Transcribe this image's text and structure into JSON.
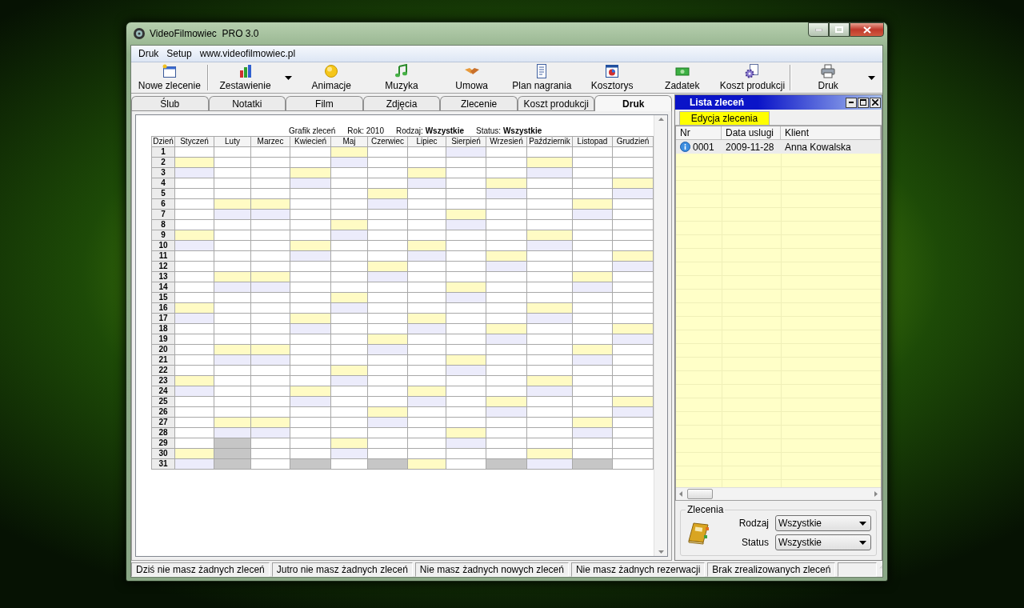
{
  "window": {
    "title": "VideoFilmowiec  PRO 3.0"
  },
  "menu": [
    "Druk",
    "Setup",
    "www.videofilmowiec.pl"
  ],
  "toolbar": [
    {
      "label": "Nowe zlecenie",
      "dropdown": false
    },
    {
      "label": "Zestawienie",
      "dropdown": true
    },
    {
      "label": "Animacje",
      "dropdown": false
    },
    {
      "label": "Muzyka",
      "dropdown": false
    },
    {
      "label": "Umowa",
      "dropdown": false
    },
    {
      "label": "Plan nagrania",
      "dropdown": false
    },
    {
      "label": "Kosztorys",
      "dropdown": false
    },
    {
      "label": "Zadatek",
      "dropdown": false
    },
    {
      "label": "Koszt produkcji",
      "dropdown": false
    },
    {
      "label": "Druk",
      "dropdown": true
    }
  ],
  "tabs": [
    {
      "label": "Ślub",
      "selected": false
    },
    {
      "label": "Notatki",
      "selected": false
    },
    {
      "label": "Film",
      "selected": false
    },
    {
      "label": "Zdjęcia",
      "selected": false
    },
    {
      "label": "Zlecenie",
      "selected": false
    },
    {
      "label": "Koszt produkcji",
      "selected": false
    },
    {
      "label": "Druk",
      "selected": true
    }
  ],
  "schedule": {
    "title": "Grafik zleceń",
    "year": "Rok: 2010",
    "type": "Rodzaj: **Wszystkie**",
    "status": "Status: **Wszystkie**",
    "corner": "Dzień",
    "months": [
      "Styczeń",
      "Luty",
      "Marzec",
      "Kwiecień",
      "Maj",
      "Czerwiec",
      "Lipiec",
      "Sierpień",
      "Wrzesień",
      "Październik",
      "Listopad",
      "Grudzień"
    ],
    "rows": [
      {
        "day": "1",
        "cells": [
          {
            "color": "#ffffff"
          },
          {
            "color": "#ffffff"
          },
          {
            "color": "#ffffff"
          },
          {
            "color": "#ffffff"
          },
          {
            "color": "#fffbc4"
          },
          {
            "color": "#ffffff"
          },
          {
            "color": "#ffffff"
          },
          {
            "color": "#ececfb"
          },
          {
            "color": "#ffffff"
          },
          {
            "color": "#ffffff"
          },
          {
            "color": "#ffffff"
          },
          {
            "color": "#ffffff"
          }
        ]
      },
      {
        "day": "2",
        "cells": [
          {
            "color": "#fffbc4"
          },
          {
            "color": "#ffffff"
          },
          {
            "color": "#ffffff"
          },
          {
            "color": "#ffffff"
          },
          {
            "color": "#ececfb"
          },
          {
            "color": "#ffffff"
          },
          {
            "color": "#ffffff"
          },
          {
            "color": "#ffffff"
          },
          {
            "color": "#ffffff"
          },
          {
            "color": "#fffbc4"
          },
          {
            "color": "#ffffff"
          },
          {
            "color": "#ffffff"
          }
        ]
      },
      {
        "day": "3",
        "cells": [
          {
            "color": "#ececfb"
          },
          {
            "color": "#ffffff"
          },
          {
            "color": "#ffffff"
          },
          {
            "color": "#fffbc4"
          },
          {
            "color": "#ffffff"
          },
          {
            "color": "#ffffff"
          },
          {
            "color": "#fffbc4"
          },
          {
            "color": "#ffffff"
          },
          {
            "color": "#ffffff"
          },
          {
            "color": "#ececfb"
          },
          {
            "color": "#ffffff"
          },
          {
            "color": "#ffffff"
          }
        ]
      },
      {
        "day": "4",
        "cells": [
          {
            "color": "#ffffff"
          },
          {
            "color": "#ffffff"
          },
          {
            "color": "#ffffff"
          },
          {
            "color": "#ececfb"
          },
          {
            "color": "#ffffff"
          },
          {
            "color": "#ffffff"
          },
          {
            "color": "#ececfb"
          },
          {
            "color": "#ffffff"
          },
          {
            "color": "#fffbc4"
          },
          {
            "color": "#ffffff"
          },
          {
            "color": "#ffffff"
          },
          {
            "color": "#fffbc4"
          }
        ]
      },
      {
        "day": "5",
        "cells": [
          {
            "color": "#ffffff"
          },
          {
            "color": "#ffffff"
          },
          {
            "color": "#ffffff"
          },
          {
            "color": "#ffffff"
          },
          {
            "color": "#ffffff"
          },
          {
            "color": "#fffbc4"
          },
          {
            "color": "#ffffff"
          },
          {
            "color": "#ffffff"
          },
          {
            "color": "#ececfb"
          },
          {
            "color": "#ffffff"
          },
          {
            "color": "#ffffff"
          },
          {
            "color": "#ececfb"
          }
        ]
      },
      {
        "day": "6",
        "cells": [
          {
            "color": "#ffffff"
          },
          {
            "color": "#fffbc4"
          },
          {
            "color": "#fffbc4"
          },
          {
            "color": "#ffffff"
          },
          {
            "color": "#ffffff"
          },
          {
            "color": "#ececfb"
          },
          {
            "color": "#ffffff"
          },
          {
            "color": "#ffffff"
          },
          {
            "color": "#ffffff"
          },
          {
            "color": "#ffffff"
          },
          {
            "color": "#fffbc4"
          },
          {
            "color": "#ffffff"
          }
        ]
      },
      {
        "day": "7",
        "cells": [
          {
            "color": "#ffffff"
          },
          {
            "color": "#ececfb"
          },
          {
            "color": "#ececfb"
          },
          {
            "color": "#ffffff"
          },
          {
            "color": "#ffffff"
          },
          {
            "color": "#ffffff"
          },
          {
            "color": "#ffffff"
          },
          {
            "color": "#fffbc4"
          },
          {
            "color": "#ffffff"
          },
          {
            "color": "#ffffff"
          },
          {
            "color": "#ececfb"
          },
          {
            "color": "#ffffff"
          }
        ]
      },
      {
        "day": "8",
        "cells": [
          {
            "color": "#ffffff"
          },
          {
            "color": "#ffffff"
          },
          {
            "color": "#ffffff"
          },
          {
            "color": "#ffffff"
          },
          {
            "color": "#fffbc4"
          },
          {
            "color": "#ffffff"
          },
          {
            "color": "#ffffff"
          },
          {
            "color": "#ececfb"
          },
          {
            "color": "#ffffff"
          },
          {
            "color": "#ffffff"
          },
          {
            "color": "#ffffff"
          },
          {
            "color": "#ffffff"
          }
        ]
      },
      {
        "day": "9",
        "cells": [
          {
            "color": "#fffbc4"
          },
          {
            "color": "#ffffff"
          },
          {
            "color": "#ffffff"
          },
          {
            "color": "#ffffff"
          },
          {
            "color": "#ececfb"
          },
          {
            "color": "#ffffff"
          },
          {
            "color": "#ffffff"
          },
          {
            "color": "#ffffff"
          },
          {
            "color": "#ffffff"
          },
          {
            "color": "#fffbc4"
          },
          {
            "color": "#ffffff"
          },
          {
            "color": "#ffffff"
          }
        ]
      },
      {
        "day": "10",
        "cells": [
          {
            "color": "#ececfb"
          },
          {
            "color": "#ffffff"
          },
          {
            "color": "#ffffff"
          },
          {
            "color": "#fffbc4"
          },
          {
            "color": "#ffffff"
          },
          {
            "color": "#ffffff"
          },
          {
            "color": "#fffbc4"
          },
          {
            "color": "#ffffff"
          },
          {
            "color": "#ffffff"
          },
          {
            "color": "#ececfb"
          },
          {
            "color": "#ffffff"
          },
          {
            "color": "#ffffff"
          }
        ]
      },
      {
        "day": "11",
        "cells": [
          {
            "color": "#ffffff"
          },
          {
            "color": "#ffffff"
          },
          {
            "color": "#ffffff"
          },
          {
            "color": "#ececfb"
          },
          {
            "color": "#ffffff"
          },
          {
            "color": "#ffffff"
          },
          {
            "color": "#ececfb"
          },
          {
            "color": "#ffffff"
          },
          {
            "color": "#fffbc4"
          },
          {
            "color": "#ffffff"
          },
          {
            "color": "#ffffff"
          },
          {
            "color": "#fffbc4"
          }
        ]
      },
      {
        "day": "12",
        "cells": [
          {
            "color": "#ffffff"
          },
          {
            "color": "#ffffff"
          },
          {
            "color": "#ffffff"
          },
          {
            "color": "#ffffff"
          },
          {
            "color": "#ffffff"
          },
          {
            "color": "#fffbc4"
          },
          {
            "color": "#ffffff"
          },
          {
            "color": "#ffffff"
          },
          {
            "color": "#ececfb"
          },
          {
            "color": "#ffffff"
          },
          {
            "color": "#ffffff"
          },
          {
            "color": "#ececfb"
          }
        ]
      },
      {
        "day": "13",
        "cells": [
          {
            "color": "#ffffff"
          },
          {
            "color": "#fffbc4"
          },
          {
            "color": "#fffbc4"
          },
          {
            "color": "#ffffff"
          },
          {
            "color": "#ffffff"
          },
          {
            "color": "#ececfb"
          },
          {
            "color": "#ffffff"
          },
          {
            "color": "#ffffff"
          },
          {
            "color": "#ffffff"
          },
          {
            "color": "#ffffff"
          },
          {
            "color": "#fffbc4"
          },
          {
            "color": "#ffffff"
          }
        ]
      },
      {
        "day": "14",
        "cells": [
          {
            "color": "#ffffff"
          },
          {
            "color": "#ececfb"
          },
          {
            "color": "#ececfb"
          },
          {
            "color": "#ffffff"
          },
          {
            "color": "#ffffff"
          },
          {
            "color": "#ffffff"
          },
          {
            "color": "#ffffff"
          },
          {
            "color": "#fffbc4"
          },
          {
            "color": "#ffffff"
          },
          {
            "color": "#ffffff"
          },
          {
            "color": "#ececfb"
          },
          {
            "color": "#ffffff"
          }
        ]
      },
      {
        "day": "15",
        "cells": [
          {
            "color": "#ffffff"
          },
          {
            "color": "#ffffff"
          },
          {
            "color": "#ffffff"
          },
          {
            "color": "#ffffff"
          },
          {
            "color": "#fffbc4"
          },
          {
            "color": "#ffffff"
          },
          {
            "color": "#ffffff"
          },
          {
            "color": "#ececfb"
          },
          {
            "color": "#ffffff"
          },
          {
            "color": "#ffffff"
          },
          {
            "color": "#ffffff"
          },
          {
            "color": "#ffffff"
          }
        ]
      },
      {
        "day": "16",
        "cells": [
          {
            "color": "#fffbc4"
          },
          {
            "color": "#ffffff"
          },
          {
            "color": "#ffffff"
          },
          {
            "color": "#ffffff"
          },
          {
            "color": "#ececfb"
          },
          {
            "color": "#ffffff"
          },
          {
            "color": "#ffffff"
          },
          {
            "color": "#ffffff"
          },
          {
            "color": "#ffffff"
          },
          {
            "color": "#fffbc4"
          },
          {
            "color": "#ffffff"
          },
          {
            "color": "#ffffff"
          }
        ]
      },
      {
        "day": "17",
        "cells": [
          {
            "color": "#ececfb"
          },
          {
            "color": "#ffffff"
          },
          {
            "color": "#ffffff"
          },
          {
            "color": "#fffbc4"
          },
          {
            "color": "#ffffff"
          },
          {
            "color": "#ffffff"
          },
          {
            "color": "#fffbc4"
          },
          {
            "color": "#ffffff"
          },
          {
            "color": "#ffffff"
          },
          {
            "color": "#ececfb"
          },
          {
            "color": "#ffffff"
          },
          {
            "color": "#ffffff"
          }
        ]
      },
      {
        "day": "18",
        "cells": [
          {
            "color": "#ffffff"
          },
          {
            "color": "#ffffff"
          },
          {
            "color": "#ffffff"
          },
          {
            "color": "#ececfb"
          },
          {
            "color": "#ffffff"
          },
          {
            "color": "#ffffff"
          },
          {
            "color": "#ececfb"
          },
          {
            "color": "#ffffff"
          },
          {
            "color": "#fffbc4"
          },
          {
            "color": "#ffffff"
          },
          {
            "color": "#ffffff"
          },
          {
            "color": "#fffbc4"
          }
        ]
      },
      {
        "day": "19",
        "cells": [
          {
            "color": "#ffffff"
          },
          {
            "color": "#ffffff"
          },
          {
            "color": "#ffffff"
          },
          {
            "color": "#ffffff"
          },
          {
            "color": "#ffffff"
          },
          {
            "color": "#fffbc4"
          },
          {
            "color": "#ffffff"
          },
          {
            "color": "#ffffff"
          },
          {
            "color": "#ececfb"
          },
          {
            "color": "#ffffff"
          },
          {
            "color": "#ffffff"
          },
          {
            "color": "#ececfb"
          }
        ]
      },
      {
        "day": "20",
        "cells": [
          {
            "color": "#ffffff"
          },
          {
            "color": "#fffbc4"
          },
          {
            "color": "#fffbc4"
          },
          {
            "color": "#ffffff"
          },
          {
            "color": "#ffffff"
          },
          {
            "color": "#ececfb"
          },
          {
            "color": "#ffffff"
          },
          {
            "color": "#ffffff"
          },
          {
            "color": "#ffffff"
          },
          {
            "color": "#ffffff"
          },
          {
            "color": "#fffbc4"
          },
          {
            "color": "#ffffff"
          }
        ]
      },
      {
        "day": "21",
        "cells": [
          {
            "color": "#ffffff"
          },
          {
            "color": "#ececfb"
          },
          {
            "color": "#ececfb"
          },
          {
            "color": "#ffffff"
          },
          {
            "color": "#ffffff"
          },
          {
            "color": "#ffffff"
          },
          {
            "color": "#ffffff"
          },
          {
            "color": "#fffbc4"
          },
          {
            "color": "#ffffff"
          },
          {
            "color": "#ffffff"
          },
          {
            "color": "#ececfb"
          },
          {
            "color": "#ffffff"
          }
        ]
      },
      {
        "day": "22",
        "cells": [
          {
            "color": "#ffffff"
          },
          {
            "color": "#ffffff"
          },
          {
            "color": "#ffffff"
          },
          {
            "color": "#ffffff"
          },
          {
            "color": "#fffbc4"
          },
          {
            "color": "#ffffff"
          },
          {
            "color": "#ffffff"
          },
          {
            "color": "#ececfb"
          },
          {
            "color": "#ffffff"
          },
          {
            "color": "#ffffff"
          },
          {
            "color": "#ffffff"
          },
          {
            "color": "#ffffff"
          }
        ]
      },
      {
        "day": "23",
        "cells": [
          {
            "color": "#fffbc4"
          },
          {
            "color": "#ffffff"
          },
          {
            "color": "#ffffff"
          },
          {
            "color": "#ffffff"
          },
          {
            "color": "#ececfb"
          },
          {
            "color": "#ffffff"
          },
          {
            "color": "#ffffff"
          },
          {
            "color": "#ffffff"
          },
          {
            "color": "#ffffff"
          },
          {
            "color": "#fffbc4"
          },
          {
            "color": "#ffffff"
          },
          {
            "color": "#ffffff"
          }
        ]
      },
      {
        "day": "24",
        "cells": [
          {
            "color": "#ececfb"
          },
          {
            "color": "#ffffff"
          },
          {
            "color": "#ffffff"
          },
          {
            "color": "#fffbc4"
          },
          {
            "color": "#ffffff"
          },
          {
            "color": "#ffffff"
          },
          {
            "color": "#fffbc4"
          },
          {
            "color": "#ffffff"
          },
          {
            "color": "#ffffff"
          },
          {
            "color": "#ececfb"
          },
          {
            "color": "#ffffff"
          },
          {
            "color": "#ffffff"
          }
        ]
      },
      {
        "day": "25",
        "cells": [
          {
            "color": "#ffffff"
          },
          {
            "color": "#ffffff"
          },
          {
            "color": "#ffffff"
          },
          {
            "color": "#ececfb"
          },
          {
            "color": "#ffffff"
          },
          {
            "color": "#ffffff"
          },
          {
            "color": "#ececfb"
          },
          {
            "color": "#ffffff"
          },
          {
            "color": "#fffbc4"
          },
          {
            "color": "#ffffff"
          },
          {
            "color": "#ffffff"
          },
          {
            "color": "#fffbc4"
          }
        ]
      },
      {
        "day": "26",
        "cells": [
          {
            "color": "#ffffff"
          },
          {
            "color": "#ffffff"
          },
          {
            "color": "#ffffff"
          },
          {
            "color": "#ffffff"
          },
          {
            "color": "#ffffff"
          },
          {
            "color": "#fffbc4"
          },
          {
            "color": "#ffffff"
          },
          {
            "color": "#ffffff"
          },
          {
            "color": "#ececfb"
          },
          {
            "color": "#ffffff"
          },
          {
            "color": "#ffffff"
          },
          {
            "color": "#ececfb"
          }
        ]
      },
      {
        "day": "27",
        "cells": [
          {
            "color": "#ffffff"
          },
          {
            "color": "#fffbc4"
          },
          {
            "color": "#fffbc4"
          },
          {
            "color": "#ffffff"
          },
          {
            "color": "#ffffff"
          },
          {
            "color": "#ececfb"
          },
          {
            "color": "#ffffff"
          },
          {
            "color": "#ffffff"
          },
          {
            "color": "#ffffff"
          },
          {
            "color": "#ffffff"
          },
          {
            "color": "#fffbc4"
          },
          {
            "color": "#ffffff"
          }
        ]
      },
      {
        "day": "28",
        "cells": [
          {
            "color": "#ffffff"
          },
          {
            "color": "#ececfb"
          },
          {
            "color": "#ececfb"
          },
          {
            "color": "#ffffff"
          },
          {
            "color": "#ffffff"
          },
          {
            "color": "#ffffff"
          },
          {
            "color": "#ffffff"
          },
          {
            "color": "#fffbc4"
          },
          {
            "color": "#ffffff"
          },
          {
            "color": "#ffffff"
          },
          {
            "color": "#ececfb"
          },
          {
            "color": "#ffffff"
          }
        ]
      },
      {
        "day": "29",
        "cells": [
          {
            "color": "#ffffff"
          },
          {
            "color": "#c6c6c6"
          },
          {
            "color": "#ffffff"
          },
          {
            "color": "#ffffff"
          },
          {
            "color": "#fffbc4"
          },
          {
            "color": "#ffffff"
          },
          {
            "color": "#ffffff"
          },
          {
            "color": "#ececfb"
          },
          {
            "color": "#ffffff"
          },
          {
            "color": "#ffffff"
          },
          {
            "color": "#ffffff"
          },
          {
            "color": "#ffffff"
          }
        ]
      },
      {
        "day": "30",
        "cells": [
          {
            "color": "#fffbc4"
          },
          {
            "color": "#c6c6c6"
          },
          {
            "color": "#ffffff"
          },
          {
            "color": "#ffffff"
          },
          {
            "color": "#ececfb"
          },
          {
            "color": "#ffffff"
          },
          {
            "color": "#ffffff"
          },
          {
            "color": "#ffffff"
          },
          {
            "color": "#ffffff"
          },
          {
            "color": "#fffbc4"
          },
          {
            "color": "#ffffff"
          },
          {
            "color": "#ffffff"
          }
        ]
      },
      {
        "day": "31",
        "cells": [
          {
            "color": "#ececfb"
          },
          {
            "color": "#c6c6c6"
          },
          {
            "color": "#ffffff"
          },
          {
            "color": "#c6c6c6"
          },
          {
            "color": "#ffffff"
          },
          {
            "color": "#c6c6c6"
          },
          {
            "color": "#fffbc4"
          },
          {
            "color": "#ffffff"
          },
          {
            "color": "#c6c6c6"
          },
          {
            "color": "#ececfb"
          },
          {
            "color": "#c6c6c6"
          },
          {
            "color": "#ffffff"
          }
        ]
      }
    ]
  },
  "orders_panel": {
    "title": "Lista zleceń",
    "edit_button": "Edycja zlecenia",
    "columns": [
      "Nr",
      "Data uslugi",
      "Klient"
    ],
    "rows": [
      {
        "nr": "0001",
        "date": "2009-11-28",
        "client": "Anna Kowalska"
      }
    ],
    "filter": {
      "title": "Zlecenia",
      "fields": [
        {
          "label": "Rodzaj",
          "value": "Wszystkie"
        },
        {
          "label": "Status",
          "value": "Wszystkie"
        }
      ]
    }
  },
  "status_bar": [
    "Dziś nie masz żadnych zleceń",
    "Jutro nie masz żadnych zleceń",
    "Nie masz żadnych nowych zleceń",
    "Nie masz żadnych rezerwacji",
    "Brak zrealizowanych zleceń"
  ]
}
